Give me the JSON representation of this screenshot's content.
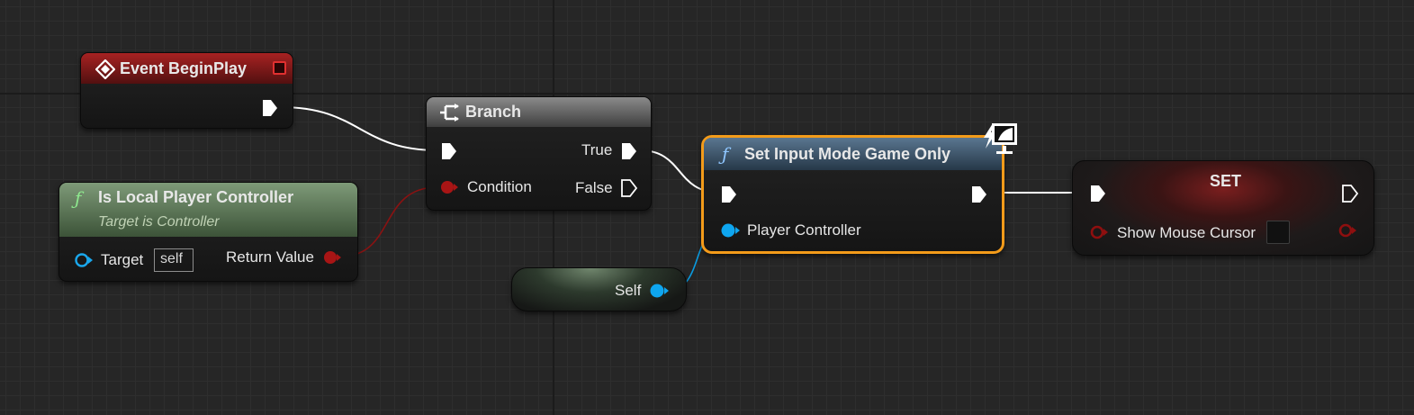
{
  "colors": {
    "exec_pin": "#ffffff",
    "bool_pin": "#8e0f0f",
    "object_pin": "#00a8f0",
    "selected_outline": "#f39b1a",
    "event_header": "#8a1818",
    "pure_function_header": "#5f7a59",
    "function_header": "#3b5168",
    "grid_background": "#262626"
  },
  "nodes": {
    "event_begin_play": {
      "title": "Event BeginPlay",
      "icon": "event-diamond-icon"
    },
    "branch": {
      "title": "Branch",
      "icon": "branch-icon",
      "condition_label": "Condition",
      "true_label": "True",
      "false_label": "False"
    },
    "is_local_player_controller": {
      "title": "Is Local Player Controller",
      "subtitle": "Target is Controller",
      "target_label": "Target",
      "target_default": "self",
      "return_label": "Return Value"
    },
    "set_input_mode": {
      "title": "Set Input Mode Game Only",
      "player_controller_label": "Player Controller",
      "badge_icon": "client-only-monitor-icon"
    },
    "self": {
      "label": "Self"
    },
    "set": {
      "title": "SET",
      "variable_label": "Show Mouse Cursor",
      "checked": false
    }
  }
}
